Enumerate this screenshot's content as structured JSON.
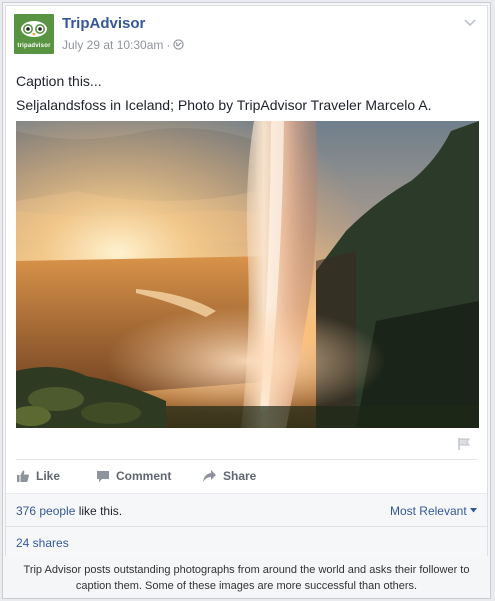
{
  "post": {
    "page_name": "TripAdvisor",
    "avatar_text": "tripadvisor",
    "timestamp": "July 29 at 10:30am",
    "separator": "·",
    "caption_line1": "Caption this...",
    "caption_line2": "Seljalandsfoss in Iceland; Photo by TripAdvisor Traveler Marcelo A."
  },
  "actions": {
    "like": "Like",
    "comment": "Comment",
    "share": "Share"
  },
  "engagement": {
    "people_link": "376 people",
    "likes_suffix": " like this.",
    "sort_label": "Most Relevant",
    "shares": "24 shares"
  },
  "footer": {
    "caption": "Trip Advisor posts outstanding photographs from around the world and asks their follower to caption them. Some of these images are more successful than others."
  },
  "colors": {
    "link": "#365899",
    "brand_green": "#589442",
    "muted": "#90949c"
  },
  "icons": [
    "owl-logo-icon",
    "globe-icon",
    "chevron-down-icon",
    "flag-icon",
    "thumbs-up-icon",
    "comment-icon",
    "share-arrow-icon",
    "caret-down-icon"
  ]
}
